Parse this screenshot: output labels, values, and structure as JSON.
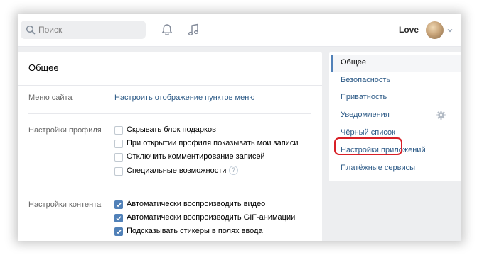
{
  "header": {
    "search_placeholder": "Поиск",
    "user_name": "Love"
  },
  "main": {
    "title": "Общее",
    "site_menu": {
      "label": "Меню сайта",
      "link": "Настроить отображение пунктов меню"
    },
    "profile_settings": {
      "label": "Настройки профиля",
      "options": [
        {
          "text": "Скрывать блок подарков",
          "checked": false
        },
        {
          "text": "При открытии профиля показывать мои записи",
          "checked": false
        },
        {
          "text": "Отключить комментирование записей",
          "checked": false
        },
        {
          "text": "Специальные возможности",
          "checked": false
        }
      ],
      "help_symbol": "?"
    },
    "content_settings": {
      "label": "Настройки контента",
      "options": [
        {
          "text": "Автоматически воспроизводить видео",
          "checked": true
        },
        {
          "text": "Автоматически воспроизводить GIF-анимации",
          "checked": true
        },
        {
          "text": "Подсказывать стикеры в полях ввода",
          "checked": true
        }
      ]
    }
  },
  "nav": {
    "items": [
      {
        "label": "Общее",
        "active": true
      },
      {
        "label": "Безопасность",
        "active": false
      },
      {
        "label": "Приватность",
        "active": false
      },
      {
        "label": "Уведомления",
        "active": false
      },
      {
        "label": "Чёрный список",
        "active": false
      },
      {
        "label": "Настройки приложений",
        "active": false
      },
      {
        "label": "Платёжные сервисы",
        "active": false
      }
    ]
  },
  "colors": {
    "accent": "#5181b8",
    "link": "#2a5885",
    "highlight": "#d81f26",
    "background": "#edeef0"
  },
  "icons": [
    "search-icon",
    "bell-icon",
    "music-icon",
    "chevron-down-icon",
    "gear-icon",
    "help-icon",
    "checkmark-icon"
  ]
}
